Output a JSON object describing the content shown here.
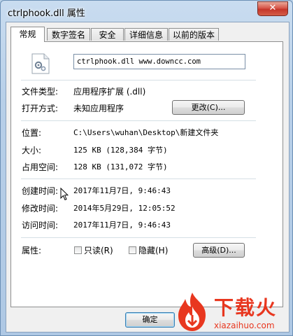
{
  "window": {
    "title": "ctrlphook.dll 属性",
    "close_glyph": "✕"
  },
  "tabs": [
    {
      "label": "常规"
    },
    {
      "label": "数字签名"
    },
    {
      "label": "安全"
    },
    {
      "label": "详细信息"
    },
    {
      "label": "以前的版本"
    }
  ],
  "general": {
    "file_name": "ctrlphook.dll www.downcc.com",
    "file_type_label": "文件类型:",
    "file_type_value": "应用程序扩展 (.dll)",
    "opens_with_label": "打开方式:",
    "opens_with_value": "未知应用程序",
    "change_button": "更改(C)...",
    "location_label": "位置:",
    "location_value": "C:\\Users\\wuhan\\Desktop\\新建文件夹",
    "size_label": "大小:",
    "size_value": "125 KB (128,384 字节)",
    "size_on_disk_label": "占用空间:",
    "size_on_disk_value": "128 KB (131,072 字节)",
    "created_label": "创建时间:",
    "created_value": "2017年11月7日, 9:46:43",
    "modified_label": "修改时间:",
    "modified_value": "2014年5月29日, 12:05:52",
    "accessed_label": "访问时间:",
    "accessed_value": "2017年11月7日, 9:46:43",
    "attributes_label": "属性:",
    "readonly_label": "只读(R)",
    "hidden_label": "隐藏(H)",
    "advanced_button": "高级(D)..."
  },
  "footer": {
    "ok_button": "确定"
  },
  "watermark": {
    "brand": "下载火",
    "url": "xiazaihuo.com"
  }
}
